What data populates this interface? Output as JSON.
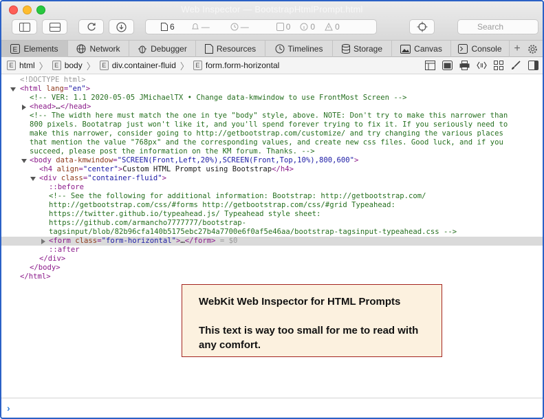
{
  "window": {
    "title": "Web Inspector — BootstrapHtmlPrompt.html"
  },
  "toolbar": {
    "activity": [
      {
        "icon": "document-icon",
        "count": "6"
      },
      {
        "icon": "bell-icon",
        "count": "—"
      },
      {
        "icon": "clock-icon",
        "count": "—"
      },
      {
        "icon": "message-icon",
        "count": "0"
      },
      {
        "icon": "info-icon",
        "count": "0"
      },
      {
        "icon": "warning-icon",
        "count": "0"
      }
    ],
    "search_placeholder": "Search"
  },
  "tabs": [
    {
      "label": "Elements",
      "icon": "elements-icon",
      "active": true
    },
    {
      "label": "Network",
      "icon": "network-icon"
    },
    {
      "label": "Debugger",
      "icon": "bug-icon"
    },
    {
      "label": "Resources",
      "icon": "resources-icon"
    },
    {
      "label": "Timelines",
      "icon": "timeline-icon"
    },
    {
      "label": "Storage",
      "icon": "storage-icon"
    },
    {
      "label": "Canvas",
      "icon": "canvas-icon"
    },
    {
      "label": "Console",
      "icon": "console-icon"
    }
  ],
  "tab_add": "+",
  "breadcrumb": {
    "tag_letter": "E",
    "items": [
      "html",
      "body",
      "div.container-fluid",
      "form.form-horizontal"
    ],
    "separator": "〉"
  },
  "dom": {
    "doctype": "<!DOCTYPE html>",
    "html_open": "html",
    "html_lang_attr": "lang",
    "html_lang_val": "\"en\"",
    "ver_comment": "<!-- VER: 1.1 2020-05-05 JMichaelTX • Change data-kmwindow to use FrontMost Screen -->",
    "head_open": "head",
    "head_ellipsis": "…",
    "head_close": "head",
    "width_comment": [
      "<!-- The width here must match the one in tye \"body\" style, above. NOTE: Don't try to make this narrower than",
      "800 pixels. Bootatrap just won't like it, and you'll spend forever trying to fix it. If you seriously need to",
      "make this narrower, consider going to http://getbootstrap.com/customize/ and try changing the various places",
      "that mention the value \"768px\" and the corresponding values, and create new css files. Good luck, and if you",
      "succeed, please post the information on the KM forum. Thanks. -->"
    ],
    "body_tag": "body",
    "body_attr": "data-kmwindow",
    "body_val": "\"SCREEN(Front,Left,20%),SCREEN(Front,Top,10%),800,600\"",
    "h4_tag": "h4",
    "h4_attr": "align",
    "h4_val": "\"center\"",
    "h4_text": "Custom HTML Prompt using Bootstrap",
    "div_tag": "div",
    "div_attr": "class",
    "div_val": "\"container-fluid\"",
    "before": "::before",
    "see_comment": [
      "<!-- See the following for additional information: Bootstrap: http://getbootstrap.com/",
      "http://getbootstrap.com/css/#forms http://getbootstrap.com/css/#grid Typeahead:",
      "https://twitter.github.io/typeahead.js/ Typeahead style sheet:",
      "https://github.com/armancho7777777/bootstrap-",
      "tagsinput/blob/82b96cfa140b5175ebc27b4a7700e6f0af5e46aa/bootstrap-tagsinput-typeahead.css -->"
    ],
    "form_tag": "form",
    "form_attr": "class",
    "form_val": "\"form-horizontal\"",
    "form_ellipsis": "…",
    "form_close": "form",
    "form_var": " = $0",
    "after": "::after",
    "div_close": "div",
    "body_close": "body",
    "html_close": "html"
  },
  "annotation": {
    "line1": "WebKit Web Inspector for HTML Prompts",
    "line2": "This text is way too small for me to read with any comfort."
  },
  "console": {
    "prompt": "›"
  }
}
